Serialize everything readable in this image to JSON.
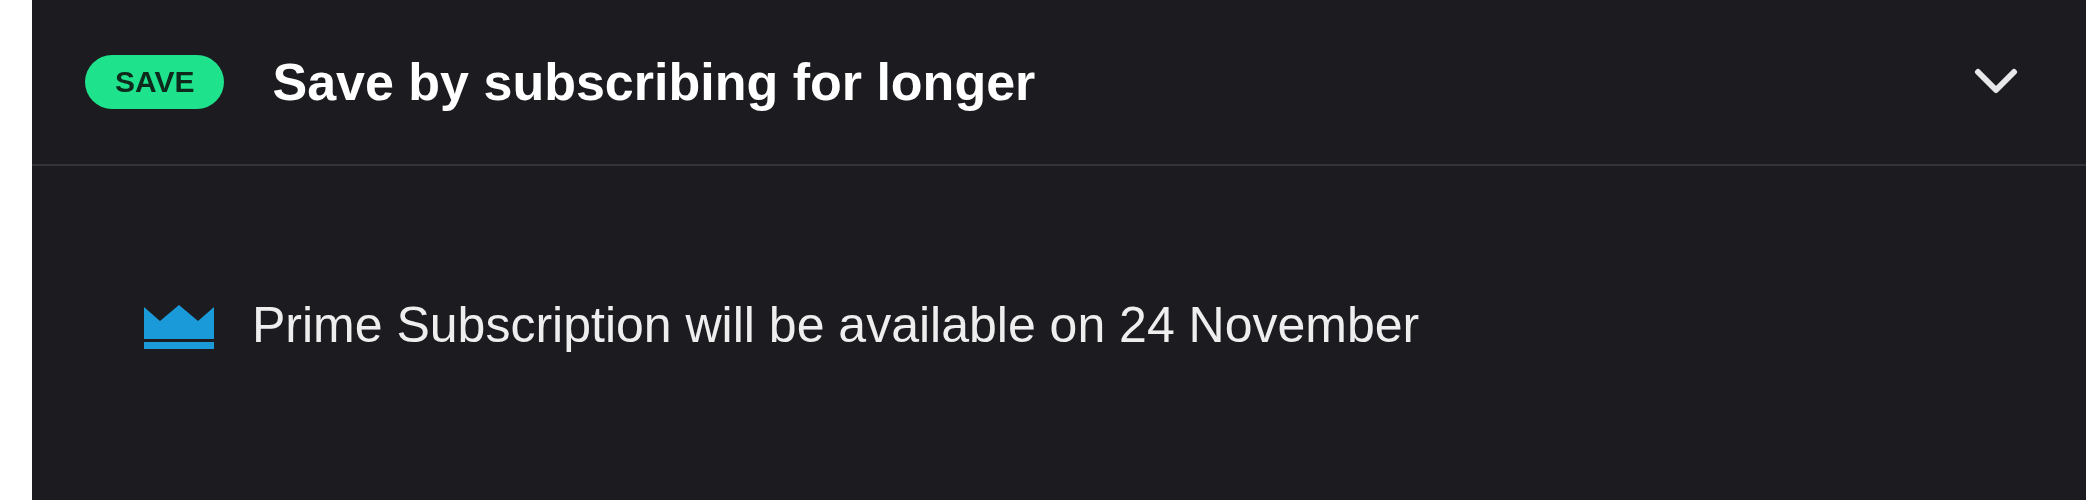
{
  "accordion": {
    "badge": "SAVE",
    "title": "Save by subscribing for longer",
    "expanded": true,
    "notice": "Prime Subscription will be available on 24 November"
  }
}
